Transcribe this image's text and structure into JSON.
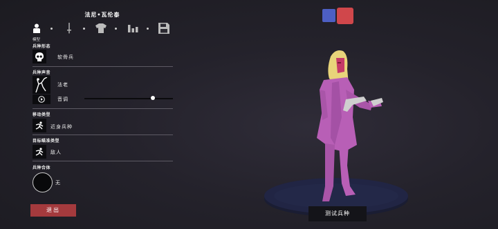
{
  "unit_name": "法尼•瓦伦泰",
  "tabs": [
    {
      "id": "model",
      "icon": "person-icon",
      "label": "模型"
    },
    {
      "id": "weapon",
      "icon": "sword-icon"
    },
    {
      "id": "armor",
      "icon": "shirt-icon"
    },
    {
      "id": "stats",
      "icon": "bar-chart-icon"
    },
    {
      "id": "save",
      "icon": "save-icon"
    }
  ],
  "sections": {
    "form": {
      "label": "兵种形态",
      "value": "软骨兵",
      "icon": "skull-icon"
    },
    "voice": {
      "label": "兵种声音",
      "value": "法老",
      "pitch_label": "音调",
      "pitch_level": 0.77,
      "icon": "voice-figure-icon",
      "play_icon": "play-icon"
    },
    "movement": {
      "label": "移动类型",
      "value": "近身兵种",
      "icon": "running-icon"
    },
    "targeting": {
      "label": "目标瞄准类型",
      "value": "敌人",
      "icon": "target-running-icon"
    },
    "combine": {
      "label": "兵种合体",
      "value": "无"
    }
  },
  "exit_label": "退出",
  "test_label": "测试兵种",
  "colors": {
    "team_blue": "#4d5fc4",
    "team_red": "#d0474b",
    "exit_red": "#a43a3d",
    "figure_pink": "#b85fb6"
  }
}
